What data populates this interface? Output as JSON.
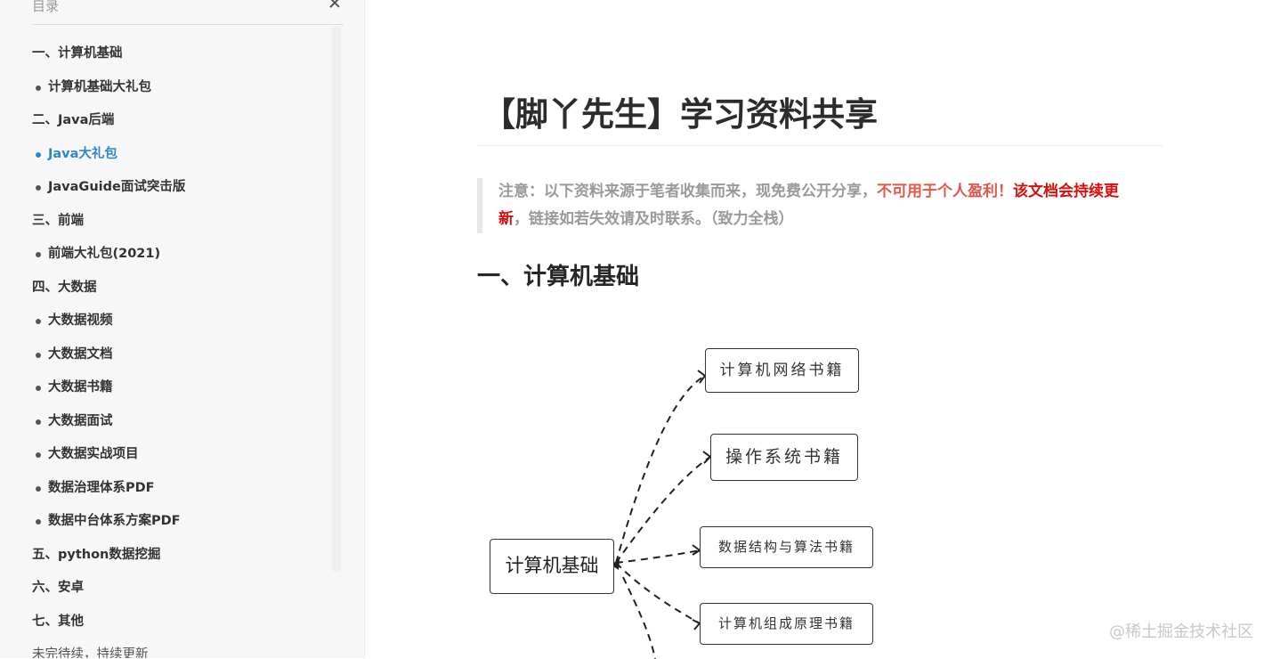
{
  "sidebar": {
    "title": "目录",
    "items": [
      {
        "label": "一、计算机基础",
        "level": 1
      },
      {
        "label": "计算机基础大礼包",
        "level": 2
      },
      {
        "label": "二、Java后端",
        "level": 1
      },
      {
        "label": "Java大礼包",
        "level": 2,
        "active": true
      },
      {
        "label": "JavaGuide面试突击版",
        "level": 2
      },
      {
        "label": "三、前端",
        "level": 1
      },
      {
        "label": "前端大礼包(2021)",
        "level": 2
      },
      {
        "label": "四、大数据",
        "level": 1
      },
      {
        "label": "大数据视频",
        "level": 2
      },
      {
        "label": "大数据文档",
        "level": 2
      },
      {
        "label": "大数据书籍",
        "level": 2
      },
      {
        "label": "大数据面试",
        "level": 2
      },
      {
        "label": "大数据实战项目",
        "level": 2
      },
      {
        "label": "数据治理体系PDF",
        "level": 2
      },
      {
        "label": "数据中台体系方案PDF",
        "level": 2
      },
      {
        "label": "五、python数据挖掘",
        "level": 1
      },
      {
        "label": "六、安卓",
        "level": 1
      },
      {
        "label": "七、其他",
        "level": 1
      },
      {
        "label": "未完待续，持续更新",
        "level": 1,
        "faded": true
      }
    ]
  },
  "article": {
    "title": "【脚丫先生】学习资料共享",
    "notice": {
      "part1": "注意：以下资料来源于笔者收集而来，现免费公开分享，",
      "part2": "不可用于个人盈利",
      "part3": "！",
      "part4": "该文档会持续更新",
      "part5": "，链接如若失效请及时联系。（致力全栈）"
    },
    "section1": "一、计算机基础"
  },
  "diagram": {
    "root": "计算机基础",
    "children": [
      "计算机网络书籍",
      "操作系统书籍",
      "数据结构与算法书籍",
      "计算机组成原理书籍"
    ]
  },
  "watermark": "@稀土掘金技术社区",
  "colors": {
    "accent": "#2f87c7",
    "warning_light": "#e0584b",
    "warning_strong": "#d90e0e"
  }
}
